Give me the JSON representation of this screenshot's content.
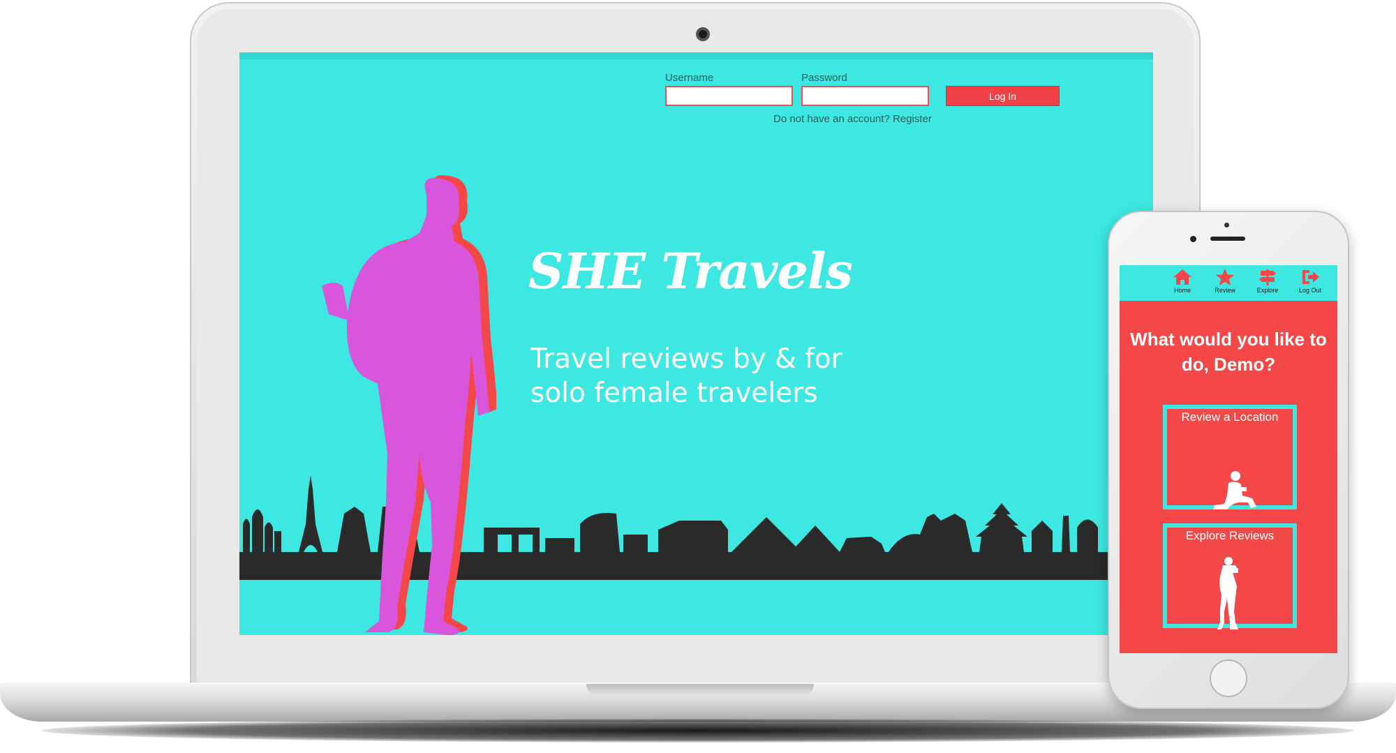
{
  "colors": {
    "accent_teal": "#3de8e2",
    "accent_red": "#f44848",
    "figure_magenta": "#d955db",
    "skyline": "#2a2a2a"
  },
  "desktop": {
    "login": {
      "username_label": "Username",
      "password_label": "Password",
      "username_value": "",
      "password_value": "",
      "login_button": "Log In",
      "register_text": "Do not have an account? Register"
    },
    "hero": {
      "title": "SHE Travels",
      "tagline": "Travel reviews by & for solo female travelers"
    }
  },
  "mobile": {
    "nav": [
      {
        "label": "Home",
        "icon": "home-icon"
      },
      {
        "label": "Review",
        "icon": "star-icon"
      },
      {
        "label": "Explore",
        "icon": "signpost-icon"
      },
      {
        "label": "Log Out",
        "icon": "logout-icon"
      }
    ],
    "heading": "What would you like to do, Demo?",
    "cards": [
      {
        "label": "Review a Location",
        "icon": "sitting-traveler-icon"
      },
      {
        "label": "Explore Reviews",
        "icon": "photographer-traveler-icon"
      }
    ]
  }
}
